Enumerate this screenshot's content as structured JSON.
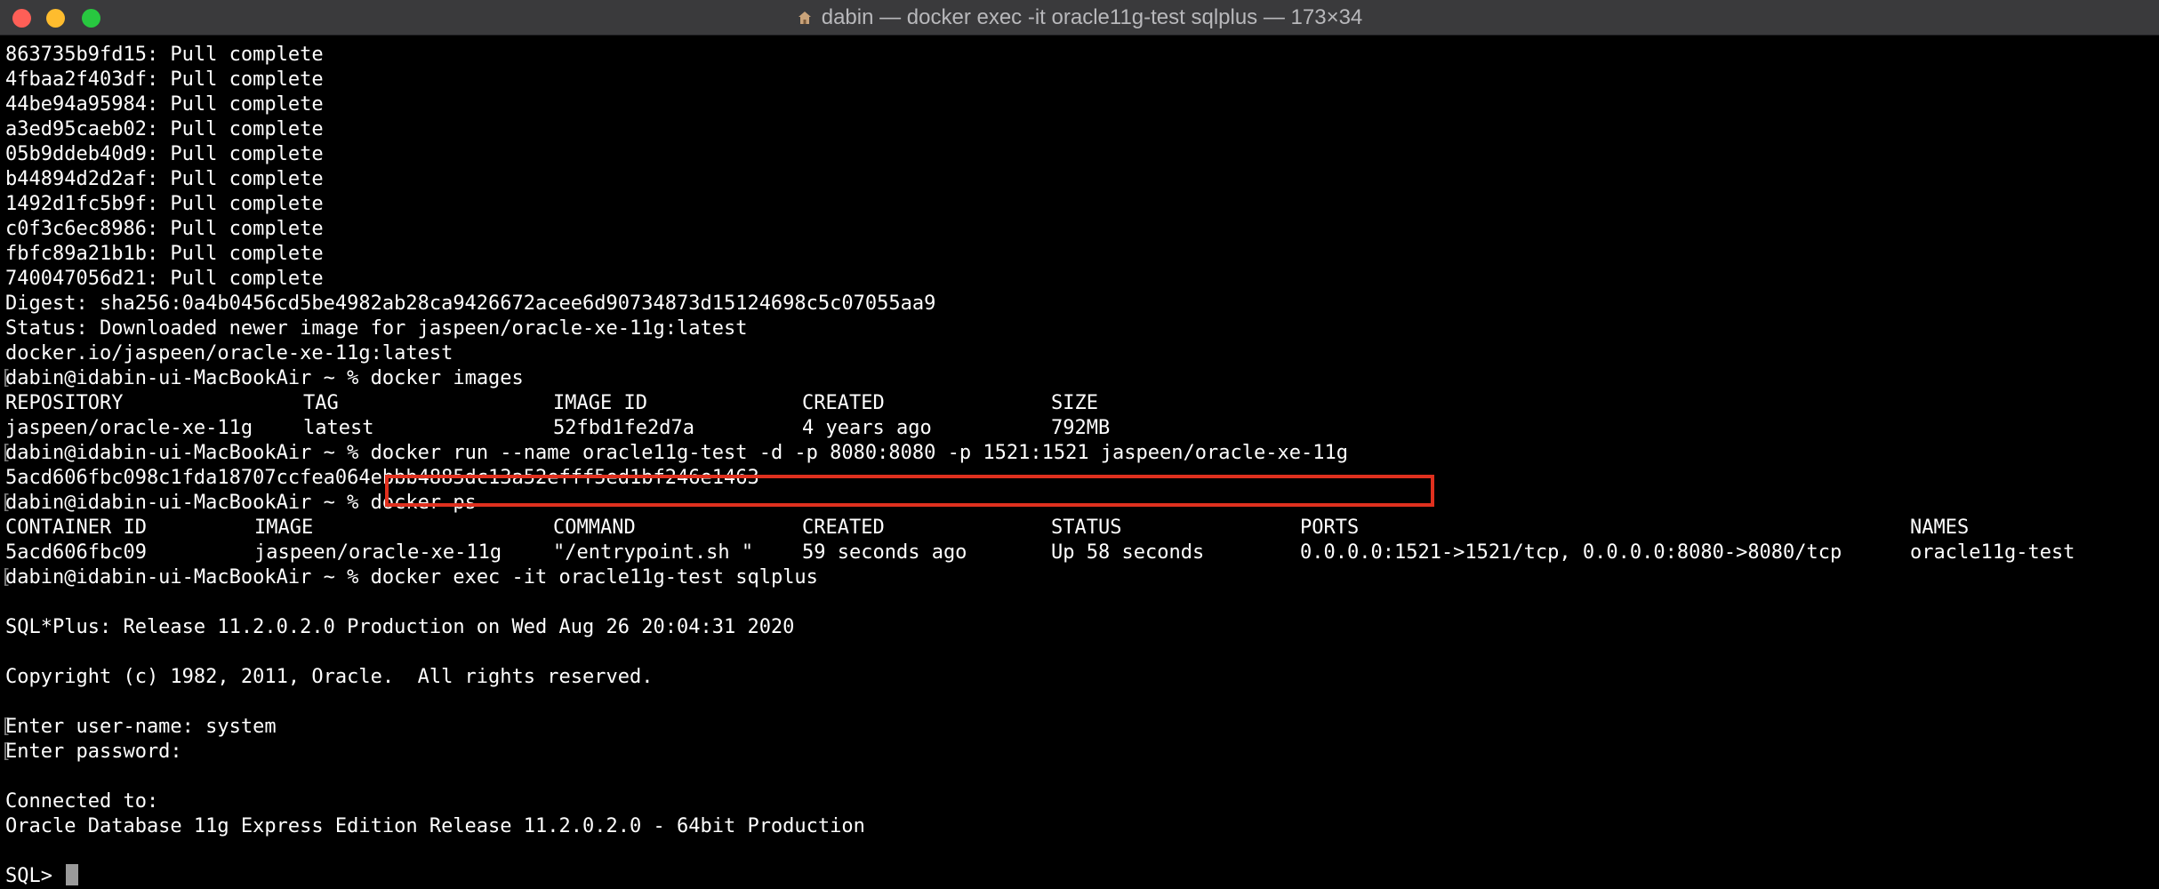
{
  "window": {
    "title": "dabin — docker exec -it oracle11g-test sqlplus — 173×34",
    "title_icon": "house-icon",
    "colors": {
      "background": "#000000",
      "text": "#ffffff",
      "titlebar": "#3a3a3c",
      "highlight": "#e0301e"
    }
  },
  "terminal": {
    "pull_lines": [
      "863735b9fd15: Pull complete",
      "4fbaa2f403df: Pull complete",
      "44be94a95984: Pull complete",
      "a3ed95caeb02: Pull complete",
      "05b9ddeb40d9: Pull complete",
      "b44894d2d2af: Pull complete",
      "1492d1fc5b9f: Pull complete",
      "c0f3c6ec8986: Pull complete",
      "fbfc89a21b1b: Pull complete",
      "740047056d21: Pull complete"
    ],
    "digest": "Digest: sha256:0a4b0456cd5be4982ab28ca9426672acee6d90734873d15124698c5c07055aa9",
    "status": "Status: Downloaded newer image for jaspeen/oracle-xe-11g:latest",
    "image_ref": "docker.io/jaspeen/oracle-xe-11g:latest",
    "prompt": "dabin@idabin-ui-MacBookAir ~ % ",
    "cmd_images": "docker images",
    "images_table": {
      "headers": [
        "REPOSITORY",
        "TAG",
        "IMAGE ID",
        "CREATED",
        "SIZE"
      ],
      "row": [
        "jaspeen/oracle-xe-11g",
        "latest",
        "52fbd1fe2d7a",
        "4 years ago",
        "792MB"
      ]
    },
    "cmd_run": "docker run --name oracle11g-test -d -p 8080:8080 -p 1521:1521 jaspeen/oracle-xe-11g",
    "run_output": "5acd606fbc098c1fda18707ccfea064ebbb4885dc13a52efff5ed1bf246e1463",
    "cmd_ps": "docker ps",
    "ps_table": {
      "headers": [
        "CONTAINER ID",
        "IMAGE",
        "COMMAND",
        "CREATED",
        "STATUS",
        "PORTS",
        "NAMES"
      ],
      "row": [
        "5acd606fbc09",
        "jaspeen/oracle-xe-11g",
        "\"/entrypoint.sh \"",
        "59 seconds ago",
        "Up 58 seconds",
        "0.0.0.0:1521->1521/tcp, 0.0.0.0:8080->8080/tcp",
        "oracle11g-test"
      ]
    },
    "cmd_exec": "docker exec -it oracle11g-test sqlplus",
    "sqlplus_banner": "SQL*Plus: Release 11.2.0.2.0 Production on Wed Aug 26 20:04:31 2020",
    "copyright": "Copyright (c) 1982, 2011, Oracle.  All rights reserved.",
    "enter_user": "Enter user-name: system",
    "enter_password": "Enter password:",
    "connected_to": "Connected to:",
    "db_version": "Oracle Database 11g Express Edition Release 11.2.0.2.0 - 64bit Production",
    "sql_prompt": "SQL> "
  }
}
